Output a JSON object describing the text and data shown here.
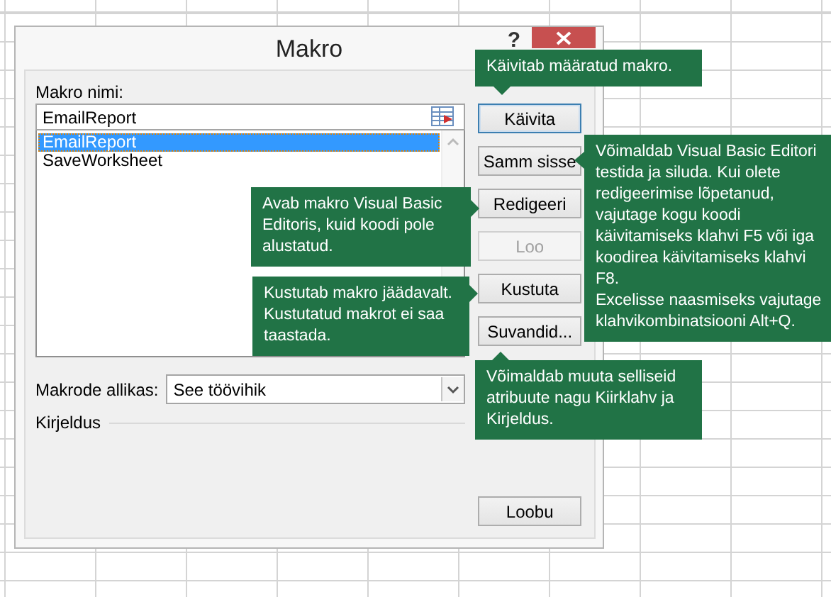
{
  "dialog": {
    "title": "Makro",
    "help": "?"
  },
  "macro_name": {
    "label": "Makro nimi:",
    "value": "EmailReport"
  },
  "macro_list": [
    {
      "name": "EmailReport",
      "selected": true
    },
    {
      "name": "SaveWorksheet",
      "selected": false
    }
  ],
  "buttons": [
    {
      "label": "Käivita",
      "disabled": false,
      "default": true
    },
    {
      "label": "Samm sisse",
      "disabled": false,
      "default": false
    },
    {
      "label": "Redigeeri",
      "disabled": false,
      "default": false
    },
    {
      "label": "Loo",
      "disabled": true,
      "default": false
    },
    {
      "label": "Kustuta",
      "disabled": false,
      "default": false
    },
    {
      "label": "Suvandid...",
      "disabled": false,
      "default": false
    },
    {
      "label": "Loobu",
      "disabled": false,
      "default": false
    }
  ],
  "macros_in": {
    "label": "Makrode allikas:",
    "value": "See töövihik"
  },
  "description": {
    "label": "Kirjeldus"
  },
  "callouts": [
    {
      "paragraphs": [
        "Käivitab määratud makro."
      ]
    },
    {
      "paragraphs": [
        "Avab makro Visual Basic Editoris, kuid koodi pole alustatud."
      ]
    },
    {
      "paragraphs": [
        "Kustutab makro jäädavalt. Kustutatud makrot ei saa taastada."
      ]
    },
    {
      "paragraphs": [
        "Võimaldab Visual Basic Editori testida ja siluda. Kui olete redigeerimise lõpetanud, vajutage kogu koodi käivitamiseks klahvi F5 või iga koodirea käivitamiseks klahvi F8.",
        "Excelisse naasmiseks vajutage klahvikombinatsiooni Alt+Q."
      ]
    },
    {
      "paragraphs": [
        "Võimaldab muuta selliseid atribuute nagu Kiirklahv ja Kirjeldus."
      ]
    }
  ]
}
